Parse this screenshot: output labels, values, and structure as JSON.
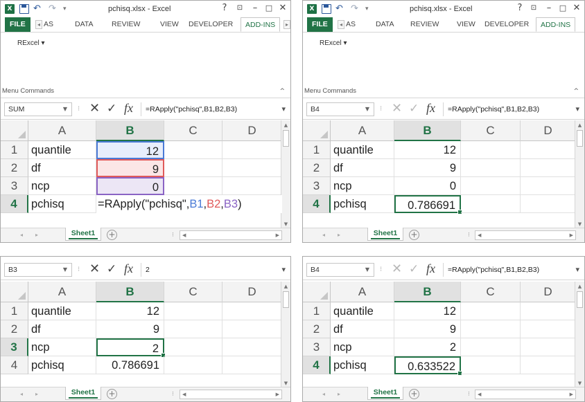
{
  "app": {
    "window_title": "pchisq.xlsx - Excel",
    "excel_logo": "X",
    "help": "?",
    "tabs": {
      "file": "FILE",
      "partial": "AS",
      "data": "DATA",
      "review": "REVIEW",
      "view": "VIEW",
      "developer": "DEVELOPER",
      "addins": "ADD-INS"
    },
    "ribbon": {
      "rexcel_menu": "RExcel ▾",
      "group_label": "Menu Commands"
    },
    "columns": [
      "A",
      "B",
      "C",
      "D"
    ],
    "rows": [
      "1",
      "2",
      "3",
      "4"
    ],
    "sheet_tab": "Sheet1",
    "fx_label": "fx",
    "accent_color": "#217346"
  },
  "panels": [
    {
      "name_box": "SUM",
      "formula": "=RApply(\"pchisq\",B1,B2,B3)",
      "labels": [
        "quantile",
        "df",
        "ncp",
        "pchisq"
      ],
      "values": [
        "12",
        "9",
        "0",
        ""
      ],
      "editing": {
        "prefix": "=RApply(\"pchisq\",",
        "ref1": "B1",
        "comma1": ",",
        "ref2": "B2",
        "comma2": ",",
        "ref3": "B3",
        "suffix": ")"
      }
    },
    {
      "name_box": "B4",
      "formula": "=RApply(\"pchisq\",B1,B2,B3)",
      "labels": [
        "quantile",
        "df",
        "ncp",
        "pchisq"
      ],
      "values": [
        "12",
        "9",
        "0",
        "0.786691"
      ]
    },
    {
      "name_box": "B3",
      "formula": "2",
      "labels": [
        "quantile",
        "df",
        "ncp",
        "pchisq"
      ],
      "values": [
        "12",
        "9",
        "2",
        "0.786691"
      ]
    },
    {
      "name_box": "B4",
      "formula": "=RApply(\"pchisq\",B1,B2,B3)",
      "labels": [
        "quantile",
        "df",
        "ncp",
        "pchisq"
      ],
      "values": [
        "12",
        "9",
        "2",
        "0.633522"
      ]
    }
  ]
}
